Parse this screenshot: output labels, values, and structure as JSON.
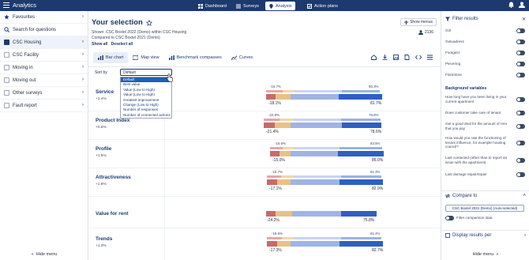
{
  "app": {
    "title": "Analytics"
  },
  "topnav": {
    "tabs": [
      {
        "label": "Dashboard",
        "icon": "dashboard-icon"
      },
      {
        "label": "Surveys",
        "icon": "surveys-icon"
      },
      {
        "label": "Analysis",
        "icon": "analysis-icon",
        "active": true
      },
      {
        "label": "Action plans",
        "icon": "action-plans-icon"
      }
    ]
  },
  "left_sidebar": {
    "items": [
      {
        "label": "Favourites",
        "icon": "star-icon",
        "trailing": "‹"
      },
      {
        "label": "Search for questions",
        "icon": "search-icon"
      },
      {
        "label": "CSC Housing",
        "checkbox": true,
        "checked": true,
        "trailing": "›"
      },
      {
        "label": "CSC Facility",
        "checkbox": true,
        "checked": false,
        "trailing": "›"
      },
      {
        "label": "Moving in",
        "checkbox": true,
        "checked": false,
        "trailing": "›"
      },
      {
        "label": "Moving out",
        "checkbox": true,
        "checked": false,
        "trailing": "›"
      },
      {
        "label": "Other surveys",
        "checkbox": true,
        "checked": false,
        "trailing": "›"
      },
      {
        "label": "Fault report",
        "checkbox": true,
        "checked": false,
        "trailing": "›"
      }
    ],
    "hide_menu": "Hide menu"
  },
  "main": {
    "title": "Your selection",
    "shown_line": "Shown: CSC Boxtel 2022 (Demo) within CSC Housing",
    "compared_line": "Compared to CSC Boxtel 2021 (Demo)",
    "show_all": "Show all",
    "deselect_all": "Deselect all",
    "show_menus": "Show menus",
    "respondents": "2136",
    "view_tabs": [
      "Bar chart",
      "Map view",
      "Benchmark compasses",
      "Curves"
    ],
    "sort_label": "Sort by",
    "sort_selected": "Default",
    "sort_options": [
      "Default",
      "Best value",
      "Value (Low to High)",
      "Value (Low to High)",
      "Greatest improvement",
      "Change (Low to High)",
      "Number of responses",
      "Number of connected actions"
    ],
    "items": [
      {
        "name": "Service",
        "delta": "+1.4%",
        "ref_low": "-16.7%",
        "ref_high": "80.3%",
        "cur_low": "-18.1%",
        "cur_high": "81.7%"
      },
      {
        "name": "Product Index",
        "delta": "+0.6%",
        "ref_low": "-22.9%",
        "ref_high": "78.6%",
        "cur_low": "-21.4%",
        "cur_high": "78.6%"
      },
      {
        "name": "Profile",
        "delta": "+1.5%",
        "ref_low": "-16.6%",
        "ref_high": "83.5%",
        "cur_low": "-15.0%",
        "cur_high": "85.0%"
      },
      {
        "name": "Attractiveness",
        "delta": "+1.8%",
        "ref_low": "-16.7%",
        "ref_high": "81.3%",
        "cur_low": "-17.1%",
        "cur_high": "82.9%"
      },
      {
        "name": "Value for rent",
        "delta": "",
        "ref_low": "",
        "ref_high": "",
        "cur_low": "-24.2%",
        "cur_high": "75.8%"
      },
      {
        "name": "Trends",
        "delta": "+1.3%",
        "ref_low": "-18.6%",
        "ref_high": "81.4%",
        "cur_low": "-17.3%",
        "cur_high": "82.7%"
      }
    ],
    "colors": {
      "neg": "#c96a6a",
      "neutral": "#e8c187",
      "light": "#9fb4e3",
      "pos": "#2f5fc2"
    }
  },
  "right_panel": {
    "filter_title": "Filter results",
    "filters": [
      "Girl",
      "Getuadress",
      "Footgest",
      "Piecering",
      "Florentore"
    ],
    "background_title": "Background variables",
    "background": [
      "How long have you been living in your current apartment",
      "Does customer take care of tenant",
      "Get a good deal for the amount of rent that you pay",
      "How would you rate the functioning of tenant influence, for example housing council?",
      "Last contacted (other than to report an issue with the apartment)",
      "Last damage repair/repair"
    ],
    "compare_title": "Compare to",
    "compare_value": "CSC Boxtel 2021 (Demo) (Auto-selected)",
    "filter_comparison": "Filter comparison data",
    "display_results": "Display results per",
    "hide_menu": "Hide menu"
  }
}
